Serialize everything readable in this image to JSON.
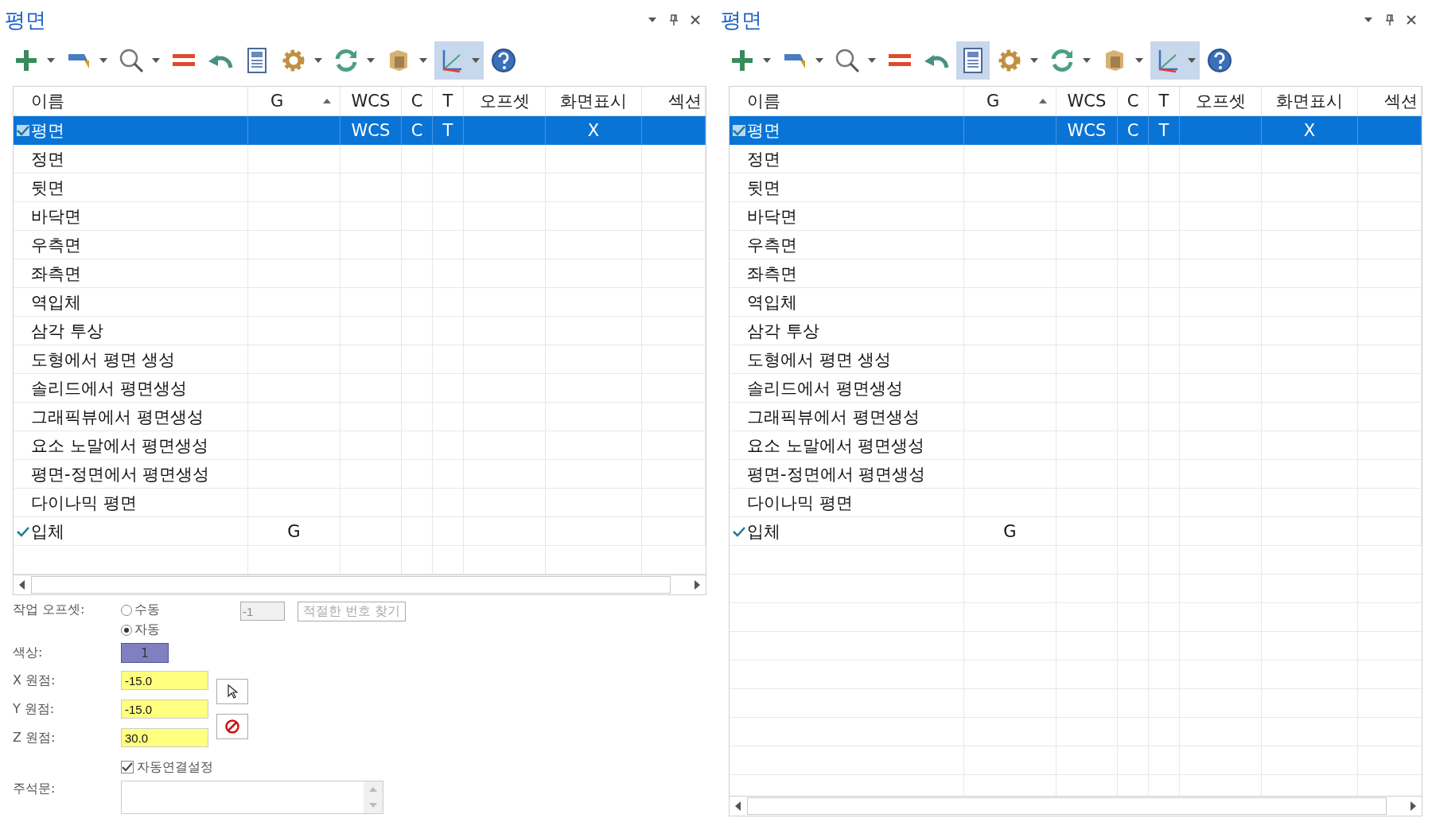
{
  "panels": [
    {
      "title": "평면",
      "toolbar": [
        {
          "kind": "add",
          "dropdown": true,
          "selected": false
        },
        {
          "kind": "flag",
          "dropdown": true,
          "selected": false
        },
        {
          "kind": "search",
          "dropdown": true,
          "selected": false
        },
        {
          "kind": "equals",
          "dropdown": false,
          "selected": false
        },
        {
          "kind": "undo",
          "dropdown": false,
          "selected": false
        },
        {
          "kind": "sheet",
          "dropdown": false,
          "selected": false
        },
        {
          "kind": "gear",
          "dropdown": true,
          "selected": false
        },
        {
          "kind": "refresh",
          "dropdown": true,
          "selected": false
        },
        {
          "kind": "box",
          "dropdown": true,
          "selected": false
        },
        {
          "kind": "axes",
          "dropdown": true,
          "selected": true
        },
        {
          "kind": "help",
          "dropdown": false,
          "selected": false
        }
      ],
      "columns": [
        "이름",
        "G",
        "WCS",
        "C",
        "T",
        "오프셋",
        "화면표시",
        "섹션"
      ],
      "rows": [
        {
          "name": "평면",
          "g": "",
          "wcs": "WCS",
          "c": "C",
          "t": "T",
          "display": "X",
          "checked": true,
          "selected": true
        },
        {
          "name": "정면",
          "checked": false,
          "selected": false
        },
        {
          "name": "뒷면",
          "checked": false,
          "selected": false
        },
        {
          "name": "바닥면",
          "checked": false,
          "selected": false
        },
        {
          "name": "우측면",
          "checked": false,
          "selected": false
        },
        {
          "name": "좌측면",
          "checked": false,
          "selected": false
        },
        {
          "name": "역입체",
          "checked": false,
          "selected": false
        },
        {
          "name": "삼각 투상",
          "checked": false,
          "selected": false
        },
        {
          "name": "도형에서 평면 생성",
          "checked": false,
          "selected": false
        },
        {
          "name": "솔리드에서 평면생성",
          "checked": false,
          "selected": false
        },
        {
          "name": "그래픽뷰에서 평면생성",
          "checked": false,
          "selected": false
        },
        {
          "name": "요소 노말에서 평면생성",
          "checked": false,
          "selected": false
        },
        {
          "name": "평면-정면에서 평면생성",
          "checked": false,
          "selected": false
        },
        {
          "name": "다이나믹 평면",
          "checked": false,
          "selected": false
        },
        {
          "name": "입체",
          "g": "G",
          "checked": true,
          "selected": false
        }
      ],
      "form": {
        "offset_label": "작업 오프셋:",
        "radios": [
          {
            "label": "수동",
            "selected": false
          },
          {
            "label": "자동",
            "selected": true
          }
        ],
        "offset_value": "-1",
        "find_button": "적절한 번호 찾기",
        "color_label": "색상:",
        "color_value": "1",
        "color": "#8080c0",
        "origins": [
          {
            "label": "X 원점:",
            "value": "-15.0"
          },
          {
            "label": "Y 원점:",
            "value": "-15.0"
          },
          {
            "label": "Z 원점:",
            "value": "30.0"
          }
        ],
        "auto_link": {
          "label": "자동연결설정",
          "checked": true
        },
        "notes_label": "주석문:"
      }
    },
    {
      "title": "평면",
      "toolbar": [
        {
          "kind": "add",
          "dropdown": true,
          "selected": false
        },
        {
          "kind": "flag",
          "dropdown": true,
          "selected": false
        },
        {
          "kind": "search",
          "dropdown": true,
          "selected": false
        },
        {
          "kind": "equals",
          "dropdown": false,
          "selected": false
        },
        {
          "kind": "undo",
          "dropdown": false,
          "selected": false
        },
        {
          "kind": "sheet",
          "dropdown": false,
          "selected": true
        },
        {
          "kind": "gear",
          "dropdown": true,
          "selected": false
        },
        {
          "kind": "refresh",
          "dropdown": true,
          "selected": false
        },
        {
          "kind": "box",
          "dropdown": true,
          "selected": false
        },
        {
          "kind": "axes",
          "dropdown": true,
          "selected": true
        },
        {
          "kind": "help",
          "dropdown": false,
          "selected": false
        }
      ],
      "columns": [
        "이름",
        "G",
        "WCS",
        "C",
        "T",
        "오프셋",
        "화면표시",
        "섹션"
      ],
      "rows": [
        {
          "name": "평면",
          "g": "",
          "wcs": "WCS",
          "c": "C",
          "t": "T",
          "display": "X",
          "checked": true,
          "selected": true
        },
        {
          "name": "정면",
          "checked": false,
          "selected": false
        },
        {
          "name": "뒷면",
          "checked": false,
          "selected": false
        },
        {
          "name": "바닥면",
          "checked": false,
          "selected": false
        },
        {
          "name": "우측면",
          "checked": false,
          "selected": false
        },
        {
          "name": "좌측면",
          "checked": false,
          "selected": false
        },
        {
          "name": "역입체",
          "checked": false,
          "selected": false
        },
        {
          "name": "삼각 투상",
          "checked": false,
          "selected": false
        },
        {
          "name": "도형에서 평면 생성",
          "checked": false,
          "selected": false
        },
        {
          "name": "솔리드에서 평면생성",
          "checked": false,
          "selected": false
        },
        {
          "name": "그래픽뷰에서 평면생성",
          "checked": false,
          "selected": false
        },
        {
          "name": "요소 노말에서 평면생성",
          "checked": false,
          "selected": false
        },
        {
          "name": "평면-정면에서 평면생성",
          "checked": false,
          "selected": false
        },
        {
          "name": "다이나믹 평면",
          "checked": false,
          "selected": false
        },
        {
          "name": "입체",
          "g": "G",
          "checked": true,
          "selected": false
        }
      ]
    }
  ]
}
